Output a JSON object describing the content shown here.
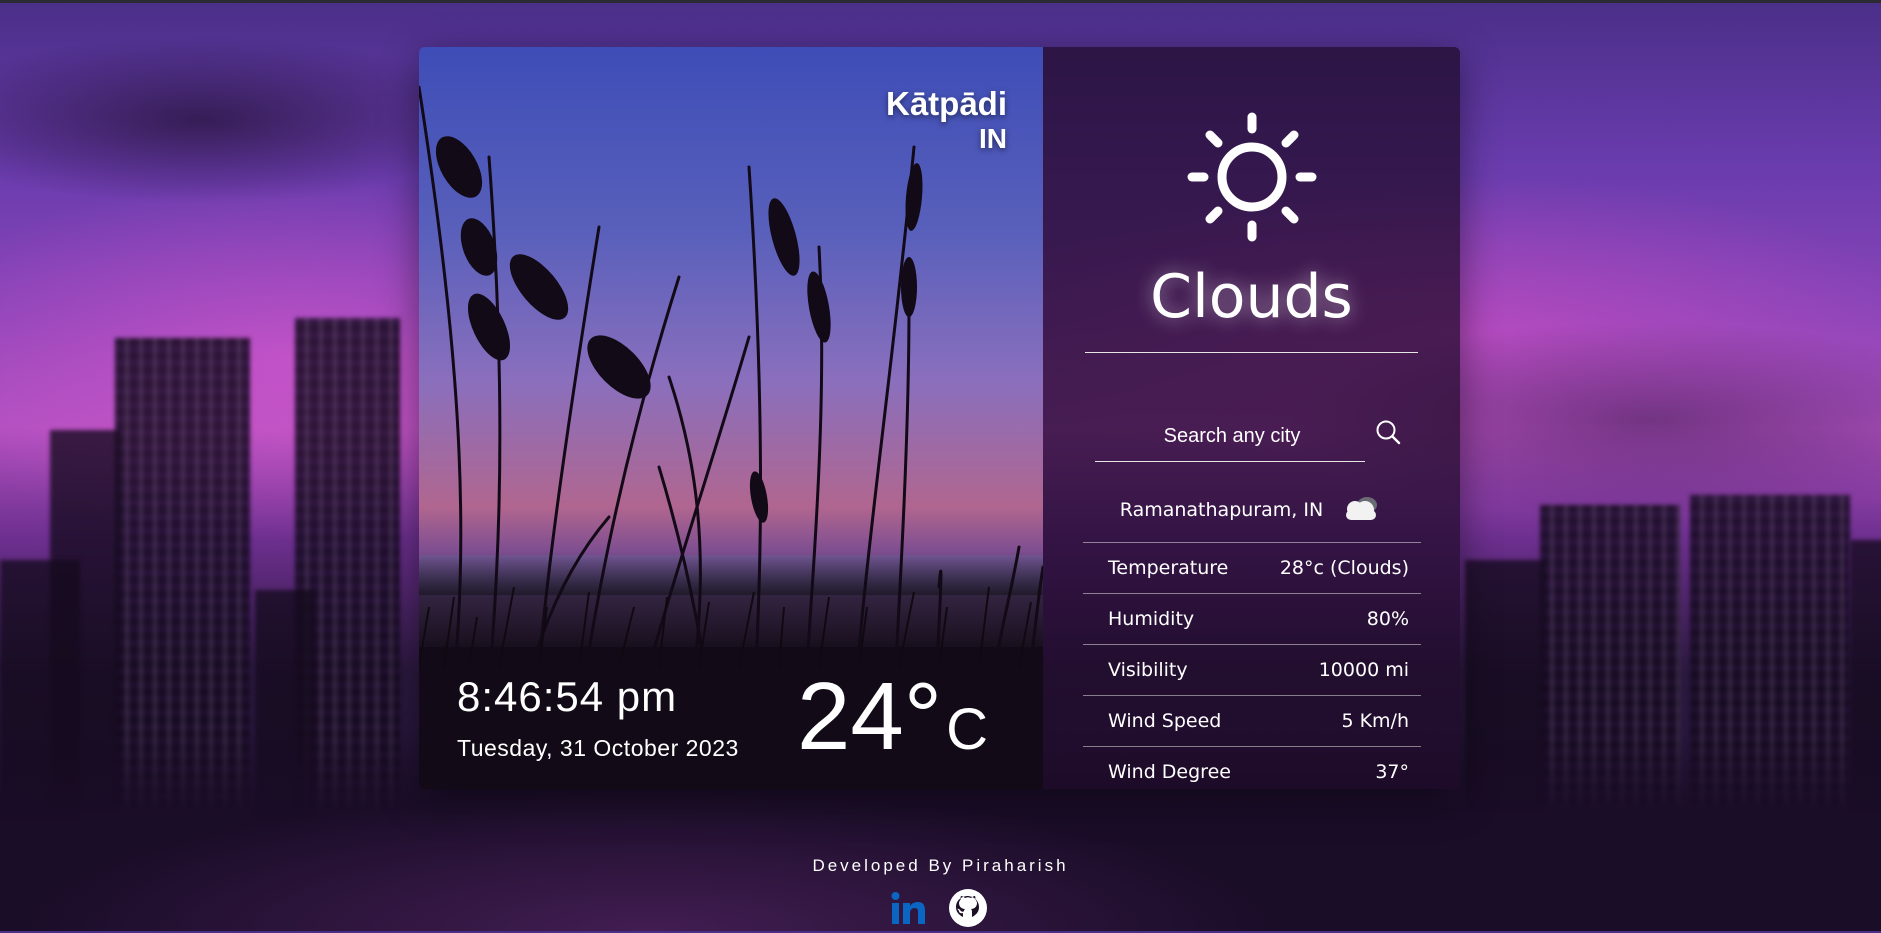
{
  "location": {
    "city": "Kātpādi",
    "country": "IN"
  },
  "clock": {
    "time": "8:46:54 pm",
    "date": "Tuesday, 31 October 2023"
  },
  "current": {
    "temp": "24°",
    "unit": "C"
  },
  "panel": {
    "weather": "Clouds",
    "search_placeholder": "Search any city",
    "result_location": "Ramanathapuram, IN",
    "details": [
      {
        "label": "Temperature",
        "value": "28°c (Clouds)"
      },
      {
        "label": "Humidity",
        "value": "80%"
      },
      {
        "label": "Visibility",
        "value": "10000 mi"
      },
      {
        "label": "Wind Speed",
        "value": "5 Km/h"
      },
      {
        "label": "Wind Degree",
        "value": "37°"
      }
    ]
  },
  "footer": {
    "credit": "Developed By Piraharish"
  },
  "icons": [
    "sun-icon",
    "search-icon",
    "cloud-icon",
    "linkedin-icon",
    "github-icon"
  ],
  "colors": {
    "linkedin": "#0a66c2",
    "accent_text": "#ffffff"
  }
}
